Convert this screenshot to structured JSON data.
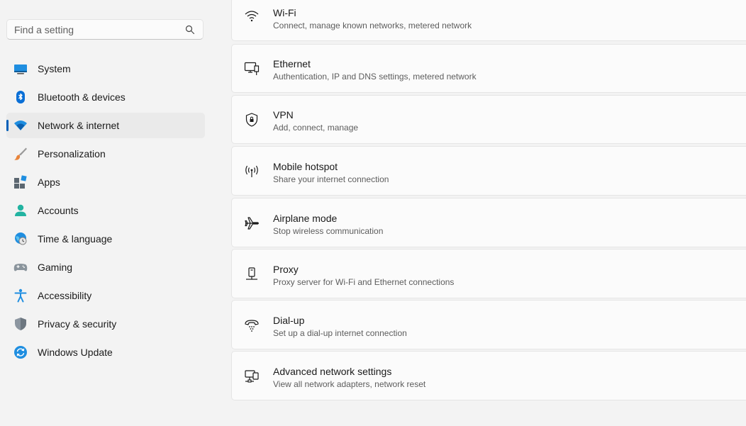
{
  "search": {
    "placeholder": "Find a setting",
    "value": ""
  },
  "sidebar": {
    "items": [
      {
        "label": "System",
        "icon": "system-icon",
        "active": false
      },
      {
        "label": "Bluetooth & devices",
        "icon": "bluetooth-icon",
        "active": false
      },
      {
        "label": "Network & internet",
        "icon": "network-icon",
        "active": true
      },
      {
        "label": "Personalization",
        "icon": "brush-icon",
        "active": false
      },
      {
        "label": "Apps",
        "icon": "apps-icon",
        "active": false
      },
      {
        "label": "Accounts",
        "icon": "account-icon",
        "active": false
      },
      {
        "label": "Time & language",
        "icon": "globe-clock-icon",
        "active": false
      },
      {
        "label": "Gaming",
        "icon": "gamepad-icon",
        "active": false
      },
      {
        "label": "Accessibility",
        "icon": "accessibility-icon",
        "active": false
      },
      {
        "label": "Privacy & security",
        "icon": "shield-icon",
        "active": false
      },
      {
        "label": "Windows Update",
        "icon": "update-icon",
        "active": false
      }
    ]
  },
  "main": {
    "cards": [
      {
        "title": "Wi-Fi",
        "description": "Connect, manage known networks, metered network",
        "icon": "wifi-icon"
      },
      {
        "title": "Ethernet",
        "description": "Authentication, IP and DNS settings, metered network",
        "icon": "ethernet-icon"
      },
      {
        "title": "VPN",
        "description": "Add, connect, manage",
        "icon": "vpn-shield-icon"
      },
      {
        "title": "Mobile hotspot",
        "description": "Share your internet connection",
        "icon": "hotspot-icon"
      },
      {
        "title": "Airplane mode",
        "description": "Stop wireless communication",
        "icon": "airplane-icon"
      },
      {
        "title": "Proxy",
        "description": "Proxy server for Wi-Fi and Ethernet connections",
        "icon": "proxy-icon"
      },
      {
        "title": "Dial-up",
        "description": "Set up a dial-up internet connection",
        "icon": "dialup-icon"
      },
      {
        "title": "Advanced network settings",
        "description": "View all network adapters, network reset",
        "icon": "advanced-network-icon"
      }
    ]
  },
  "colors": {
    "accent": "#005fb8",
    "background": "#f3f3f3",
    "card": "#fbfbfb"
  }
}
